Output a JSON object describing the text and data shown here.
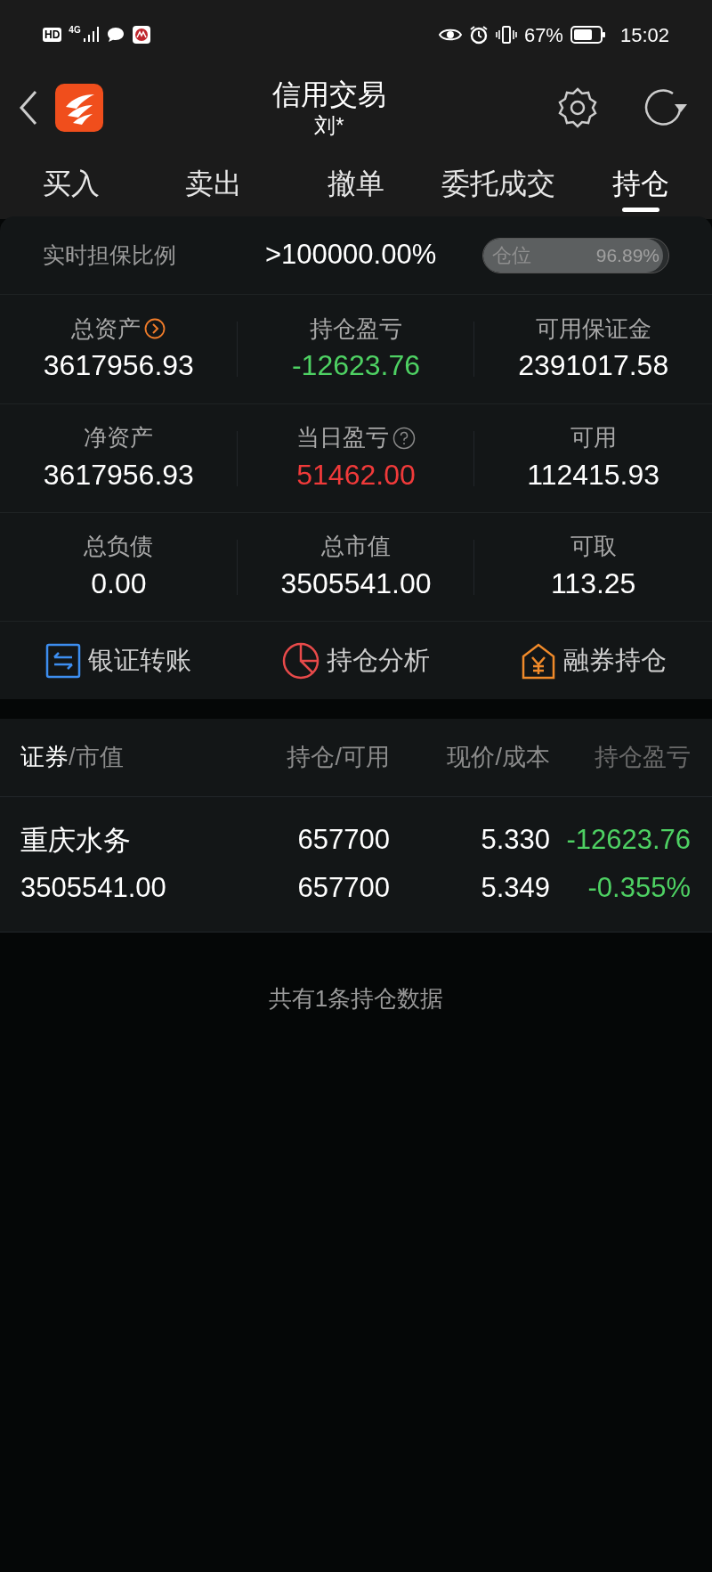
{
  "status_bar": {
    "hd": "HD",
    "network": "4G",
    "battery": "67%",
    "time": "15:02"
  },
  "header": {
    "title": "信用交易",
    "subtitle": "刘*"
  },
  "tabs": [
    {
      "label": "买入",
      "selected": false
    },
    {
      "label": "卖出",
      "selected": false
    },
    {
      "label": "撤单",
      "selected": false
    },
    {
      "label": "委托成交",
      "selected": false
    },
    {
      "label": "持仓",
      "selected": true
    }
  ],
  "ratio": {
    "label": "实时担保比例",
    "value": ">100000.00%",
    "position": {
      "label": "仓位",
      "reading": "96.89%",
      "level": 0.9689
    }
  },
  "metrics": [
    {
      "label": "总资产",
      "value": "3617956.93",
      "color": "#ffffff",
      "kind": "link"
    },
    {
      "label": "持仓盈亏",
      "value": "-12623.76",
      "color": "#4ed163",
      "kind": "plain"
    },
    {
      "label": "可用保证金",
      "value": "2391017.58",
      "color": "#ffffff",
      "kind": "plain"
    },
    {
      "label": "净资产",
      "value": "3617956.93",
      "color": "#ffffff",
      "kind": "plain"
    },
    {
      "label": "当日盈亏",
      "value": "51462.00",
      "color": "#f03a3a",
      "kind": "help"
    },
    {
      "label": "可用",
      "value": "112415.93",
      "color": "#ffffff",
      "kind": "plain"
    },
    {
      "label": "总负债",
      "value": "0.00",
      "color": "#ffffff",
      "kind": "plain"
    },
    {
      "label": "总市值",
      "value": "3505541.00",
      "color": "#ffffff",
      "kind": "plain"
    },
    {
      "label": "可取",
      "value": "113.25",
      "color": "#ffffff",
      "kind": "plain"
    }
  ],
  "actions": [
    {
      "label": "银证转账",
      "kind": "transfer"
    },
    {
      "label": "持仓分析",
      "kind": "analysis"
    },
    {
      "label": "融券持仓",
      "kind": "lending"
    }
  ],
  "table": {
    "columns": [
      {
        "label": "证券",
        "sub_label": "/市值"
      },
      {
        "label": "持仓/可用"
      },
      {
        "label": "现价/成本"
      },
      {
        "label": "持仓盈亏"
      }
    ],
    "rows": [
      {
        "name": "重庆水务",
        "market_value": "3505541.00",
        "holding": "657700",
        "available": "657700",
        "price": "5.330",
        "cost": "5.349",
        "pnl": "-12623.76",
        "pnl_ratio": "-0.355%",
        "color": "#4ed163"
      }
    ]
  },
  "footer": "共有1条持仓数据"
}
